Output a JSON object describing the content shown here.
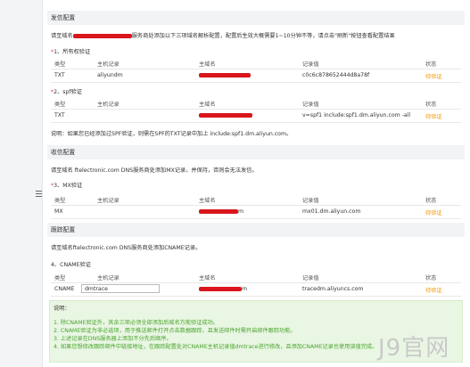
{
  "sections": {
    "send": {
      "title": "发信配置",
      "desc_prefix": "请至域名",
      "desc_suffix": "服务商处添加以下三项域名解析配置，配置后生效大概需要1~10分钟不等，请点击\"刷新\"按钮查看配置结果",
      "ownership": {
        "label": "1、所有权验证",
        "headers": [
          "类型",
          "主机记录",
          "主域名",
          "记录值",
          "状态"
        ],
        "row": {
          "type": "TXT",
          "host": "aliyundm",
          "value": "c0c6c878652444d8a78f",
          "status": "待验证"
        }
      },
      "spf": {
        "label": "2、spf验证",
        "headers": [
          "类型",
          "主机记录",
          "主域名",
          "记录值",
          "状态"
        ],
        "row": {
          "type": "TXT",
          "host": "",
          "value": "v=spf1 include:spf1.dm.aliyun.com -all",
          "status": "待验证"
        },
        "note": "说明：如果您已经添加过SPF验证，则需在SPF的TXT记录中加上 include:spf1.dm.aliyun.com。"
      }
    },
    "receive": {
      "title": "收信配置",
      "desc": "请至域名 ftelectronic.com DNS服务商处添加MX记录，并保持，否则会无法发信。",
      "mx": {
        "label": "3、MX验证",
        "headers": [
          "类型",
          "主机记录",
          "主域名",
          "记录值",
          "状态"
        ],
        "row": {
          "type": "MX",
          "host": "",
          "domain_tail": "m",
          "value": "mx01.dm.aliyun.com",
          "status": "待验证"
        }
      }
    },
    "track": {
      "title": "跟踪配置",
      "desc": "请至域名ftelectronic.com DNS服务商处添加CNAME记录。",
      "cname": {
        "label": "4、CNAME验证",
        "headers": [
          "类型",
          "主机记录",
          "主域名",
          "记录值",
          "状态"
        ],
        "row": {
          "type": "CNAME",
          "host": "dmtrace",
          "domain_tail": "m",
          "value": "tracedm.aliyuncs.com",
          "status": "待验证"
        }
      }
    }
  },
  "notes": {
    "title": "说明：",
    "lines": [
      "1. 除CNAME验证外，其余三项必须全部添加后域名方能验证成功。",
      "2. CNAME验证为非必选项，用于推送邮件打开点击数据跟踪，且发送邮件时需开启邮件跟踪功能。",
      "3. 上述记录在DNS服务器上添加不分先后顺序。",
      "4. 如果您想修改跟踪邮件中链接地址，在跟踪配置处对CNAME主机记录值dmtrace进行修改，且添加CNAME记录也使用该值完成。"
    ]
  },
  "watermark": "J9官网",
  "colors": {
    "pending": "#f39800",
    "required_star": "#e4393c",
    "note_text": "#4aa52e",
    "note_bg": "#e9f6e3",
    "redaction": "#d9161b"
  }
}
